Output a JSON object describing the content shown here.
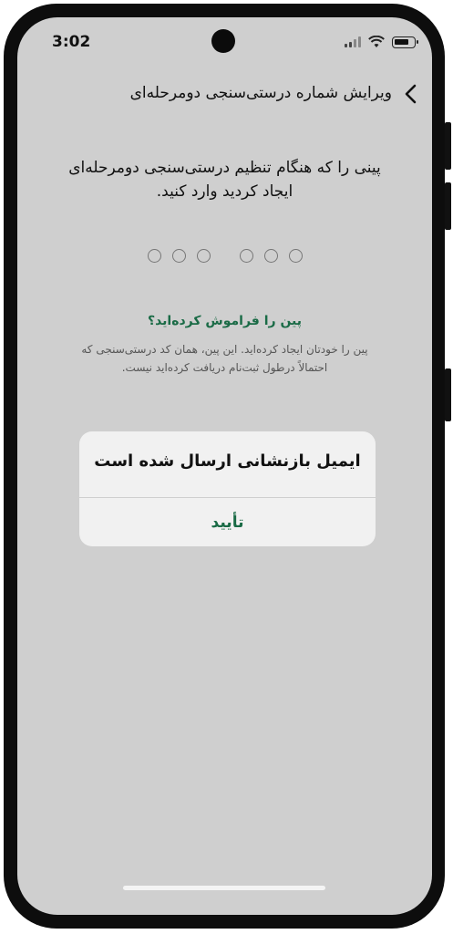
{
  "status_bar": {
    "time": "3:02",
    "icons": [
      "signal-icon",
      "wifi-icon",
      "battery-icon"
    ]
  },
  "header": {
    "title": "ویرایش شماره درستی‌سنجی دومرحله‌ای",
    "back_icon": "chevron-back-icon"
  },
  "prompt": {
    "line1": "پینی را که هنگام تنظیم درستی‌سنجی دومرحله‌ای",
    "line2": "ایجاد کردید وارد کنید."
  },
  "pin": {
    "length": 6,
    "filled": 0
  },
  "forgot": {
    "link": "پین را فراموش کرده‌اید؟",
    "help_line1": "پین را خودتان ایجاد کرده‌اید. این پین، همان کد درستی‌سنجی که",
    "help_line2": "احتمالاً درطول ثبت‌نام دریافت کرده‌اید نیست."
  },
  "alert": {
    "title": "ایمیل بازنشانی ارسال شده است",
    "confirm_label": "تأیید"
  },
  "colors": {
    "accent": "#1a6b46",
    "screen_dim": "#cfcfcf",
    "alert_bg": "#f1f1f1"
  }
}
